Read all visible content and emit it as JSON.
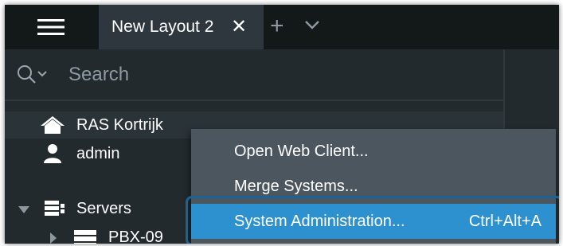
{
  "tabbar": {
    "menu_icon": "hamburger-menu-icon",
    "tab_label": "New Layout 2",
    "tab_close": "✕",
    "add_tab": "+",
    "more_tabs_icon": "chevron-down-icon"
  },
  "search": {
    "icon": "search-icon",
    "placeholder": "Search"
  },
  "tree": {
    "system_name": "RAS Kortrijk",
    "user_name": "admin",
    "servers_label": "Servers",
    "server_item": "PBX-09"
  },
  "context_menu": {
    "items": [
      {
        "label": "Open Web Client...",
        "shortcut": ""
      },
      {
        "label": "Merge Systems...",
        "shortcut": ""
      },
      {
        "label": "System Administration...",
        "shortcut": "Ctrl+Alt+A"
      }
    ]
  },
  "colors": {
    "accent": "#2d90cf",
    "highlight_outline": "#1b6396"
  }
}
